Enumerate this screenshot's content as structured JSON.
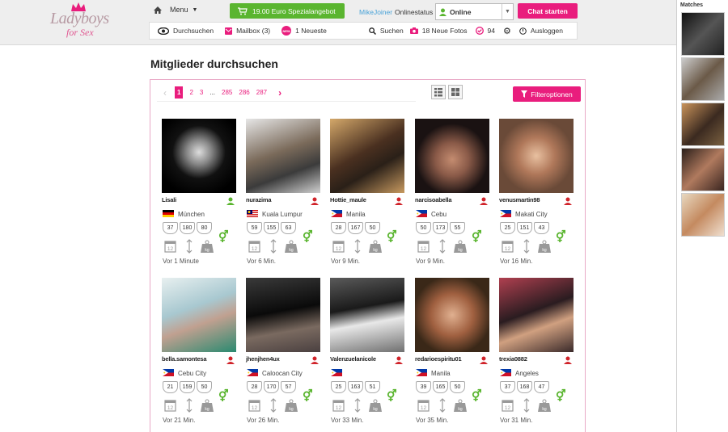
{
  "logo": {
    "line1": "Ladyboys",
    "line2": "for Sex"
  },
  "topbar": {
    "menu_label": "Menu",
    "offer_label": "19.00 Euro Spezialangebot",
    "username": "MikeJoiner",
    "status_label": "Onlinestatus",
    "status_value": "Online",
    "chat_button": "Chat starten"
  },
  "nav": {
    "items": [
      {
        "label": "Durchsuchen",
        "icon": "eye-icon"
      },
      {
        "label": "Mailbox (3)",
        "icon": "mail-icon"
      },
      {
        "label": "1 Neueste",
        "icon": "new-badge-icon",
        "badge": "NEW"
      },
      {
        "label": "Suchen",
        "icon": "search-icon"
      },
      {
        "label": "18 Neue Fotos",
        "icon": "camera-icon"
      },
      {
        "label": "94",
        "icon": "heart-check-icon"
      },
      {
        "label": "",
        "icon": "gear-icon"
      },
      {
        "label": "Ausloggen",
        "icon": "power-icon"
      }
    ]
  },
  "sidebar": {
    "title": "Matches"
  },
  "page": {
    "title": "Mitglieder durchsuchen"
  },
  "pager": {
    "prev": "‹",
    "pages": [
      "1",
      "2",
      "3",
      "...",
      "285",
      "286",
      "287"
    ],
    "active": "1",
    "next": "›"
  },
  "filter": {
    "label": "Filteroptionen"
  },
  "members": [
    {
      "name": "Lisali",
      "city": "München",
      "flag": "de",
      "stats": [
        "37",
        "180",
        "80"
      ],
      "time": "Vor 1 Minute",
      "online": true
    },
    {
      "name": "nurazima",
      "city": "Kuala Lumpur",
      "flag": "my",
      "stats": [
        "59",
        "155",
        "63"
      ],
      "time": "Vor 6 Min.",
      "online": false
    },
    {
      "name": "Hottie_maule",
      "city": "Manila",
      "flag": "ph",
      "stats": [
        "28",
        "167",
        "50"
      ],
      "time": "Vor 9 Min.",
      "online": false
    },
    {
      "name": "narcisoabella",
      "city": "Cebu",
      "flag": "ph",
      "stats": [
        "50",
        "173",
        "55"
      ],
      "time": "Vor 9 Min.",
      "online": false
    },
    {
      "name": "venusmartin98",
      "city": "Makati City",
      "flag": "ph",
      "stats": [
        "25",
        "151",
        "43"
      ],
      "time": "Vor 16 Min.",
      "online": false
    },
    {
      "name": "bella.samontesa",
      "city": "Cebu City",
      "flag": "ph",
      "stats": [
        "21",
        "159",
        "50"
      ],
      "time": "Vor 21 Min.",
      "online": false
    },
    {
      "name": "jhenjhen4ux",
      "city": "Caloocan City",
      "flag": "ph",
      "stats": [
        "28",
        "170",
        "57"
      ],
      "time": "Vor 26 Min.",
      "online": false
    },
    {
      "name": "Valenzuelanicole",
      "city": "",
      "flag": "ph",
      "stats": [
        "25",
        "163",
        "51"
      ],
      "time": "Vor 33 Min.",
      "online": false
    },
    {
      "name": "redarioespiritu01",
      "city": "Manila",
      "flag": "ph",
      "stats": [
        "39",
        "165",
        "50"
      ],
      "time": "Vor 35 Min.",
      "online": false
    },
    {
      "name": "trexia0882",
      "city": "Angeles",
      "flag": "ph",
      "stats": [
        "37",
        "168",
        "47"
      ],
      "time": "Vor 31 Min.",
      "online": false
    }
  ],
  "colors": {
    "accent": "#e91d7d",
    "green": "#5ab52f",
    "link": "#4aa3d8",
    "panel_border": "#e9a9c6"
  }
}
